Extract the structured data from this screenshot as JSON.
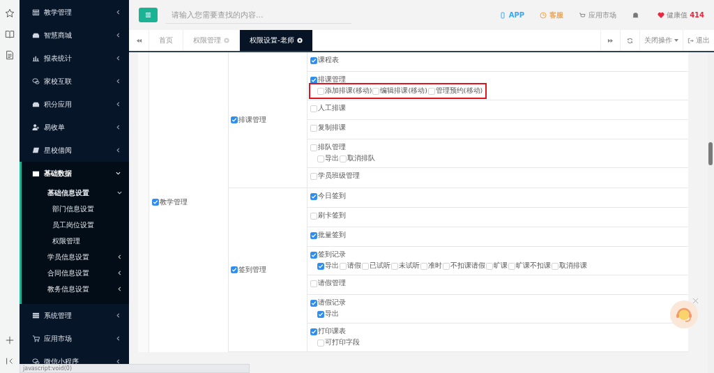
{
  "sidebar": {
    "items": [
      {
        "label": "教学管理",
        "expanded": false
      },
      {
        "label": "智慧商城",
        "expanded": false
      },
      {
        "label": "报表统计",
        "expanded": false
      },
      {
        "label": "家校互联",
        "expanded": false
      },
      {
        "label": "积分应用",
        "expanded": false
      },
      {
        "label": "易收单",
        "expanded": false
      },
      {
        "label": "星校借阅",
        "expanded": false
      },
      {
        "label": "基础数据",
        "expanded": true,
        "children": [
          {
            "label": "基础信息设置",
            "expanded": true,
            "children": [
              {
                "label": "部门信息设置"
              },
              {
                "label": "员工岗位设置"
              },
              {
                "label": "权限管理"
              }
            ]
          },
          {
            "label": "学员信息设置",
            "expanded": false
          },
          {
            "label": "合同信息设置",
            "expanded": false
          },
          {
            "label": "教务信息设置",
            "expanded": false
          }
        ]
      },
      {
        "label": "系统管理",
        "expanded": false
      },
      {
        "label": "应用市场",
        "expanded": false
      },
      {
        "label": "微信小程序",
        "expanded": false
      }
    ]
  },
  "status_text": "javascript:void(0)",
  "topbar": {
    "search": {
      "placeholder": "请输入您需要查找的内容..."
    },
    "links": [
      {
        "label": "APP",
        "color": "#3aa8f0"
      },
      {
        "label": "客服",
        "color": "#f5a34a"
      },
      {
        "label": "应用市场",
        "color": "#888888"
      }
    ],
    "health": {
      "label": "健康值",
      "value": "414"
    }
  },
  "tabs": [
    {
      "label": "首页",
      "selected": false,
      "closable": false
    },
    {
      "label": "权限管理",
      "selected": false,
      "closable": true
    },
    {
      "label": "权限设置-老师",
      "selected": true,
      "closable": true
    }
  ],
  "tab_actions": {
    "close_menu": "关闭操作",
    "logout": "退出"
  },
  "table": {
    "module": {
      "label": "教学管理",
      "checked": true
    },
    "groups": [
      {
        "label": "排课管理",
        "checked": true,
        "items": [
          {
            "label": "课程表",
            "checked": true
          },
          {
            "label": "排课管理",
            "checked": true,
            "highlighted": true,
            "children": [
              {
                "label": "添加排课(移动)",
                "checked": false
              },
              {
                "label": "编辑排课(移动)",
                "checked": false
              },
              {
                "label": "管理预约(移动)",
                "checked": false
              }
            ]
          },
          {
            "label": "人工排课",
            "checked": false
          },
          {
            "label": "复制排课",
            "checked": false
          },
          {
            "label": "排队管理",
            "checked": false,
            "highlighted": false,
            "children": [
              {
                "label": "导出",
                "checked": false
              },
              {
                "label": "取消排队",
                "checked": false
              }
            ]
          },
          {
            "label": "学员班级管理",
            "checked": false
          }
        ]
      },
      {
        "label": "签到管理",
        "checked": true,
        "items": [
          {
            "label": "今日签到",
            "checked": true
          },
          {
            "label": "刷卡签到",
            "checked": false
          },
          {
            "label": "批量签到",
            "checked": true
          },
          {
            "label": "签到记录",
            "checked": true,
            "highlighted": false,
            "children": [
              {
                "label": "导出",
                "checked": true
              },
              {
                "label": "请假",
                "checked": false
              },
              {
                "label": "已试听",
                "checked": false
              },
              {
                "label": "未试听",
                "checked": false
              },
              {
                "label": "准时",
                "checked": false
              },
              {
                "label": "不扣课请假",
                "checked": false
              },
              {
                "label": "旷课",
                "checked": false
              },
              {
                "label": "旷课不扣课",
                "checked": false
              },
              {
                "label": "取消排课",
                "checked": false
              }
            ]
          },
          {
            "label": "请假管理",
            "checked": false
          },
          {
            "label": "请假记录",
            "checked": true,
            "highlighted": false,
            "children": [
              {
                "label": "导出",
                "checked": true
              }
            ]
          },
          {
            "label": "打印课表",
            "checked": true,
            "highlighted": false,
            "children": [
              {
                "label": "可打印字段",
                "checked": false
              }
            ]
          }
        ]
      }
    ]
  }
}
